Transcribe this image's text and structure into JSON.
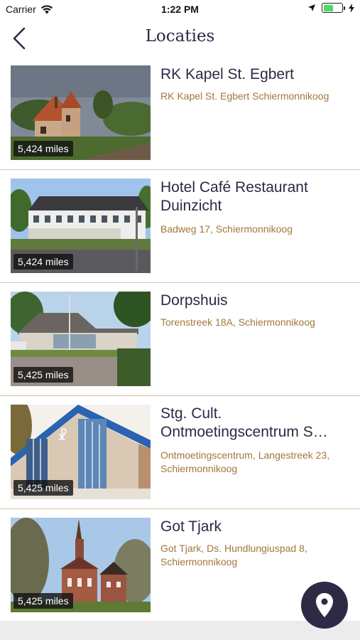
{
  "status_bar": {
    "carrier": "Carrier",
    "time": "1:22 PM"
  },
  "nav": {
    "title": "Locaties",
    "back_icon": "chevron-left-icon"
  },
  "locations": [
    {
      "name": "RK Kapel St. Egbert",
      "address": "RK Kapel St. Egbert Schiermonnikoog",
      "distance": "5,424 miles"
    },
    {
      "name": "Hotel Café Restaurant Duinzicht",
      "address": "Badweg 17, Schiermonnikoog",
      "distance": "5,424 miles"
    },
    {
      "name": "Dorpshuis",
      "address": "Torenstreek 18A, Schiermonnikoog",
      "distance": "5,425 miles"
    },
    {
      "name": "Stg. Cult. Ontmoetingscentrum S…",
      "address": "Ontmoetingscentrum, Langestreek 23, Schiermonnikoog",
      "distance": "5,425 miles"
    },
    {
      "name": "Got Tjark",
      "address": "Got Tjark, Ds. Hundlungiuspad 8, Schiermonnikoog",
      "distance": "5,425 miles"
    }
  ],
  "map_button": {
    "icon": "location-pin-icon"
  },
  "colors": {
    "primary": "#2e2a46",
    "address": "#a0773a",
    "divider": "#d8c3a6"
  }
}
